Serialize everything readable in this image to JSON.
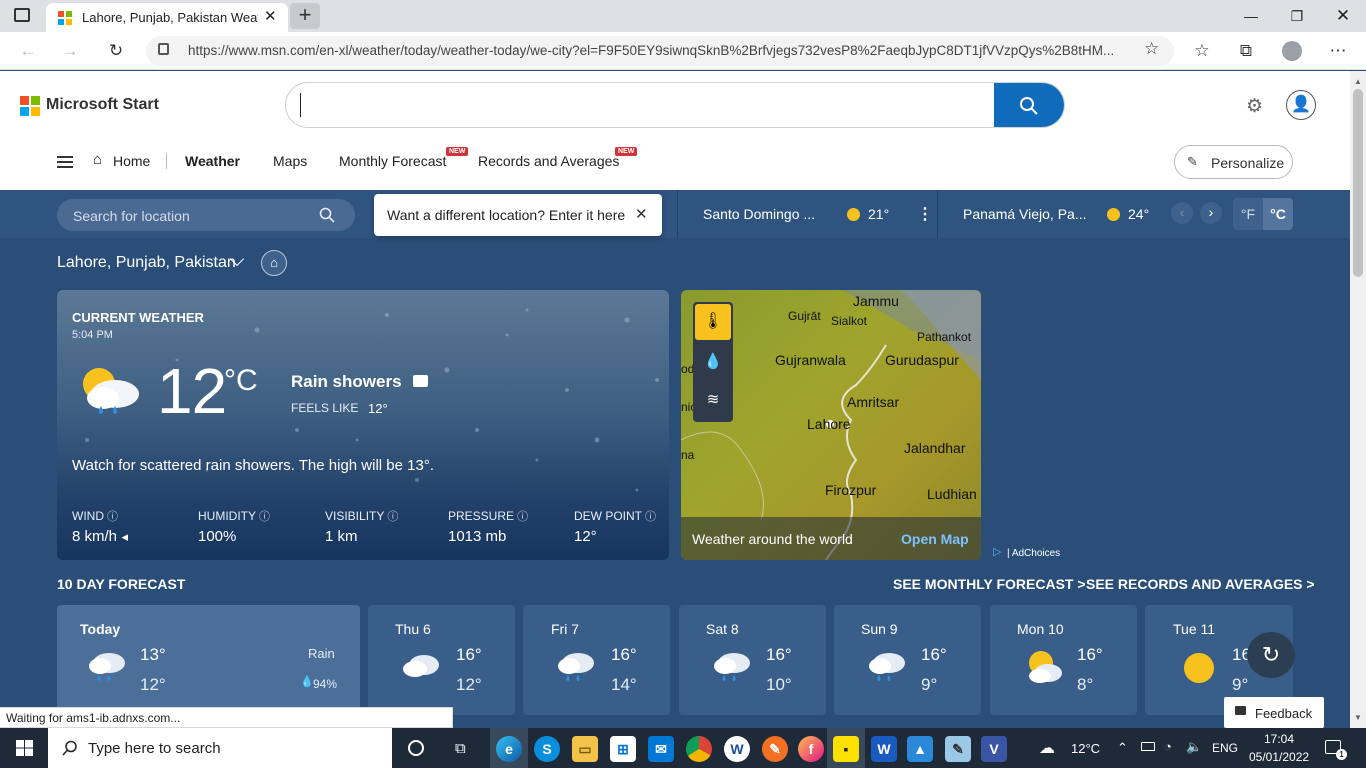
{
  "browser": {
    "tab_title": "Lahore, Punjab, Pakistan Weathe",
    "url": "https://www.msn.com/en-xl/weather/today/weather-today/we-city?el=F9F50EY9siwnqSknB%2Brfvjegs732vesP8%2FaeqbJypC8DT1jfVVzpQys%2B8tHM...",
    "status_text": "Waiting for ams1-ib.adnxs.com..."
  },
  "header": {
    "logo_text": "Microsoft Start",
    "search_value": "",
    "nav": [
      {
        "label": "Home"
      },
      {
        "label": "Weather"
      },
      {
        "label": "Maps"
      },
      {
        "label": "Monthly Forecast",
        "badge": "NEW"
      },
      {
        "label": "Records and Averages",
        "badge": "NEW"
      }
    ],
    "personalize_label": "Personalize"
  },
  "weather_bar": {
    "search_placeholder": "Search for location",
    "tooltip": "Want a different location? Enter it here",
    "locations": [
      {
        "name": "Santo Domingo ...",
        "temp": "21°"
      },
      {
        "name": "Panamá Viejo, Pa...",
        "temp": "24°"
      }
    ],
    "unit_f": "°F",
    "unit_c": "°C"
  },
  "location": {
    "name": "Lahore, Punjab, Pakistan"
  },
  "current": {
    "label": "CURRENT WEATHER",
    "time": "5:04 PM",
    "temp": "12",
    "unit": "°C",
    "condition": "Rain showers",
    "feels_like_label": "FEELS LIKE",
    "feels_like": "12°",
    "summary": "Watch for scattered rain showers. The high will be 13°.",
    "details": [
      {
        "label": "WIND",
        "value": "8 km/h"
      },
      {
        "label": "HUMIDITY",
        "value": "100%"
      },
      {
        "label": "VISIBILITY",
        "value": "1 km"
      },
      {
        "label": "PRESSURE",
        "value": "1013 mb"
      },
      {
        "label": "DEW POINT",
        "value": "12°"
      }
    ]
  },
  "map": {
    "places": [
      "Jammu",
      "Gujrāt",
      "Sialkot",
      "Pathankot",
      "Gujranwala",
      "Gurudaspur",
      "Amritsar",
      "Lahore",
      "Jalandhar",
      "Firozpur",
      "Ludhian",
      "od",
      "nic",
      "na"
    ],
    "footer": "Weather around the world",
    "open_map": "Open Map",
    "adchoices": "| AdChoices"
  },
  "forecast": {
    "title": "10 DAY FORECAST",
    "monthly_link": "SEE MONTHLY FORECAST >",
    "records_link": "SEE RECORDS AND AVERAGES >",
    "today": {
      "day": "Today",
      "hi": "13°",
      "lo": "12°",
      "precip_label": "Rain",
      "precip": "94%"
    },
    "days": [
      {
        "day": "Thu 6",
        "hi": "16°",
        "lo": "12°",
        "icon": "cloud-icon"
      },
      {
        "day": "Fri 7",
        "hi": "16°",
        "lo": "14°",
        "icon": "rain-cloud-icon"
      },
      {
        "day": "Sat 8",
        "hi": "16°",
        "lo": "10°",
        "icon": "rain-cloud-icon"
      },
      {
        "day": "Sun 9",
        "hi": "16°",
        "lo": "9°",
        "icon": "rain-cloud-icon"
      },
      {
        "day": "Mon 10",
        "hi": "16°",
        "lo": "8°",
        "icon": "partly-cloudy-icon"
      },
      {
        "day": "Tue 11",
        "hi": "16",
        "lo": "9°",
        "icon": "sun-icon"
      }
    ]
  },
  "feedback_label": "Feedback",
  "taskbar": {
    "search_placeholder": "Type here to search",
    "weather_temp": "12°C",
    "language": "ENG",
    "time": "17:04",
    "date": "05/01/2022",
    "notification_count": "1"
  },
  "colors": {
    "accent": "#0f6cbd",
    "page_bg": "#2b4e79",
    "sun": "#f8c21e"
  }
}
